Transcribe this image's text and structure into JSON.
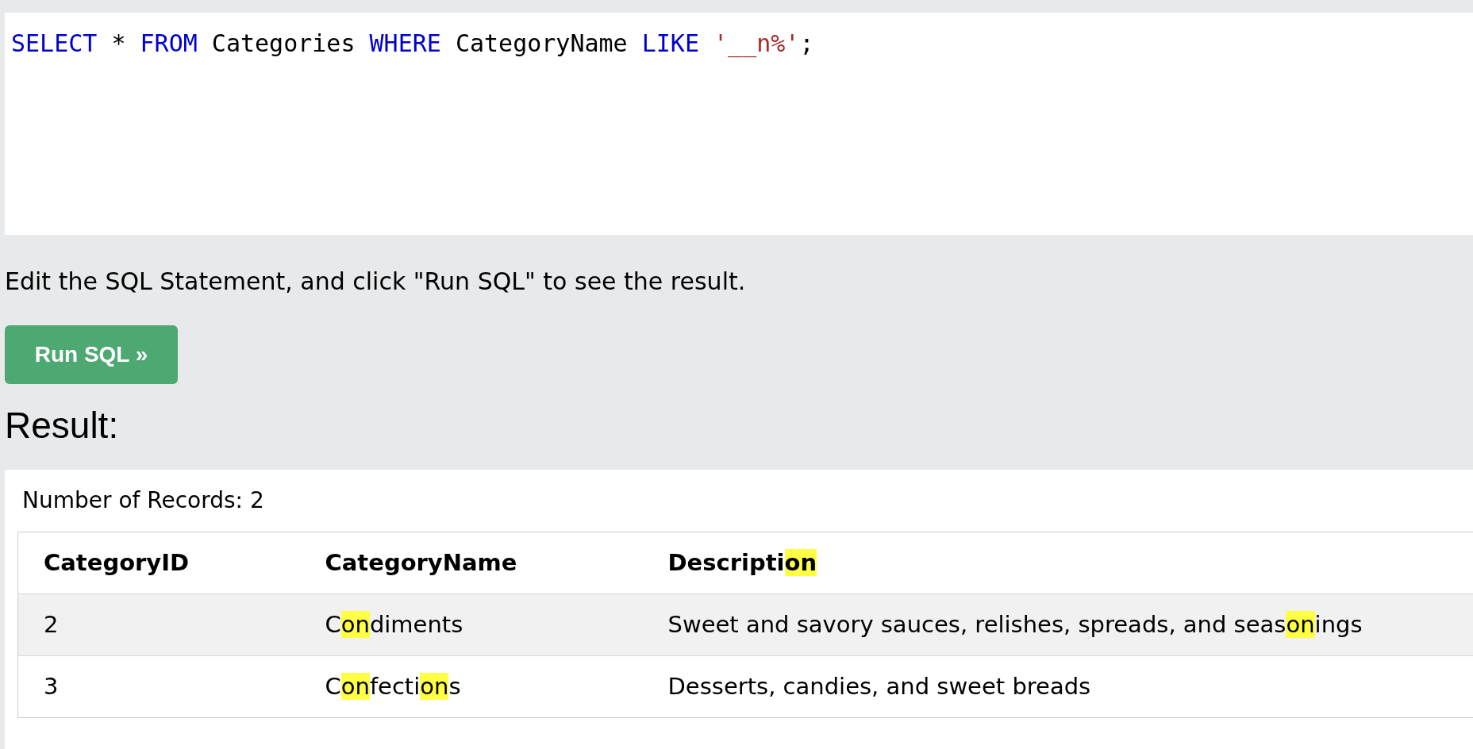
{
  "editor": {
    "tokens": [
      {
        "kind": "keyword",
        "text": "SELECT"
      },
      {
        "kind": "plain",
        "text": " * "
      },
      {
        "kind": "keyword",
        "text": "FROM"
      },
      {
        "kind": "plain",
        "text": " Categories "
      },
      {
        "kind": "keyword",
        "text": "WHERE"
      },
      {
        "kind": "plain",
        "text": " CategoryName "
      },
      {
        "kind": "keyword",
        "text": "LIKE"
      },
      {
        "kind": "string",
        "text": " '__n%'"
      },
      {
        "kind": "plain",
        "text": ";"
      }
    ]
  },
  "instructions": "Edit the SQL Statement, and click \"Run SQL\" to see the result.",
  "run_button": "Run SQL »",
  "result_heading": "Result:",
  "record_count": "Number of Records: 2",
  "table": {
    "columns": [
      {
        "segments": [
          {
            "text": "CategoryID",
            "highlight": false
          }
        ]
      },
      {
        "segments": [
          {
            "text": "CategoryName",
            "highlight": false
          }
        ]
      },
      {
        "segments": [
          {
            "text": "Descripti",
            "highlight": false
          },
          {
            "text": "on",
            "highlight": true
          }
        ]
      }
    ],
    "rows": [
      {
        "shaded": true,
        "cells": [
          {
            "segments": [
              {
                "text": "2",
                "highlight": false
              }
            ]
          },
          {
            "segments": [
              {
                "text": "C",
                "highlight": false
              },
              {
                "text": "on",
                "highlight": true
              },
              {
                "text": "diments",
                "highlight": false
              }
            ]
          },
          {
            "segments": [
              {
                "text": "Sweet and savory sauces, relishes, spreads, and seas",
                "highlight": false
              },
              {
                "text": "on",
                "highlight": true
              },
              {
                "text": "ings",
                "highlight": false
              }
            ]
          }
        ]
      },
      {
        "shaded": false,
        "cells": [
          {
            "segments": [
              {
                "text": "3",
                "highlight": false
              }
            ]
          },
          {
            "segments": [
              {
                "text": "C",
                "highlight": false
              },
              {
                "text": "on",
                "highlight": true
              },
              {
                "text": "fecti",
                "highlight": false
              },
              {
                "text": "on",
                "highlight": true
              },
              {
                "text": "s",
                "highlight": false
              }
            ]
          },
          {
            "segments": [
              {
                "text": "Desserts, candies, and sweet breads",
                "highlight": false
              }
            ]
          }
        ]
      }
    ]
  }
}
